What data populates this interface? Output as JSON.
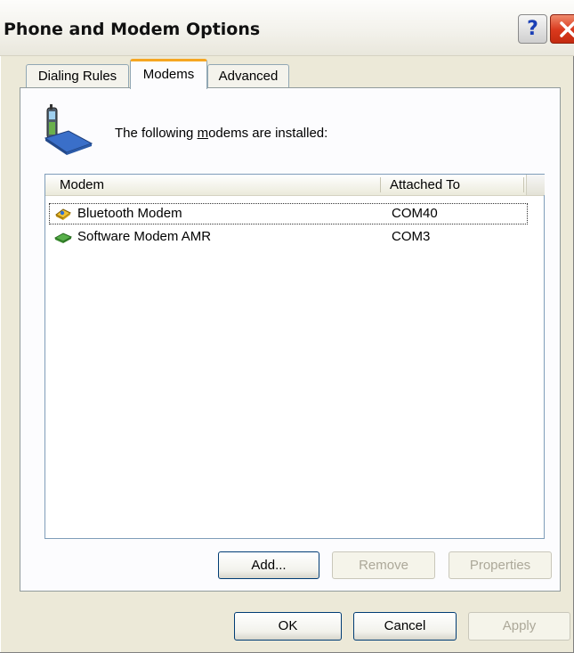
{
  "window": {
    "title": "Phone and Modem Options",
    "help_label": "?",
    "close_label": "×"
  },
  "tabs": [
    {
      "label": "Dialing Rules",
      "active": false
    },
    {
      "label": "Modems",
      "active": true
    },
    {
      "label": "Advanced",
      "active": false
    }
  ],
  "panel": {
    "intro_prefix": "The following ",
    "intro_mnemonic": "m",
    "intro_suffix": "odems are  installed:",
    "icon": "phone-modem-icon"
  },
  "modems_list": {
    "columns": [
      "Modem",
      "Attached To"
    ],
    "rows": [
      {
        "name": "Bluetooth Modem",
        "port": "COM40",
        "icon": "bluetooth-modem-icon",
        "selected": true
      },
      {
        "name": "Software Modem AMR",
        "port": "COM3",
        "icon": "software-modem-icon",
        "selected": false
      }
    ]
  },
  "panel_buttons": {
    "add": "Add...",
    "remove": "Remove",
    "properties": "Properties"
  },
  "dialog_buttons": {
    "ok": "OK",
    "cancel": "Cancel",
    "apply": "Apply"
  },
  "colors": {
    "dialog_bg": "#ece9d8",
    "active_tab_accent": "#f5a623",
    "close_button": "#d9381c",
    "border_blue": "#003c74"
  }
}
